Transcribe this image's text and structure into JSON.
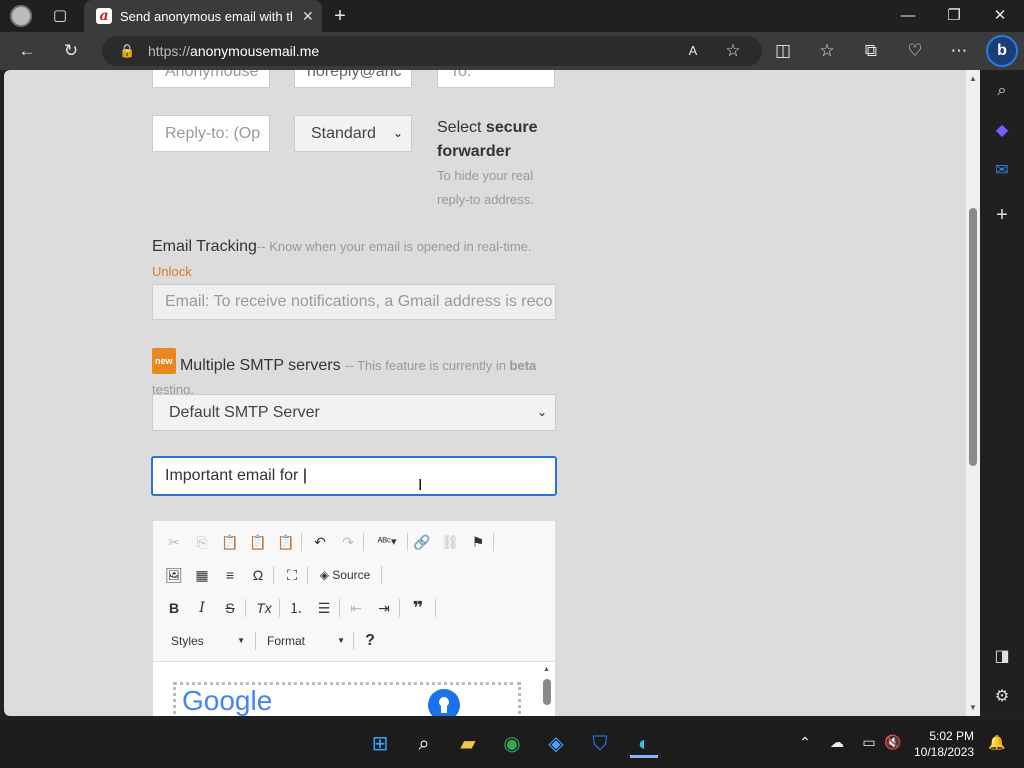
{
  "browser": {
    "tab_title": "Send anonymous email with the",
    "url_scheme": "https://",
    "url_host": "anonymousemail.me"
  },
  "form": {
    "from_name_value": "Anonymouse",
    "from_email_value": "noreply@anc",
    "to_placeholder": "To:",
    "reply_to_placeholder": "Reply-to: (Op",
    "priority_value": "Standard",
    "secure_text_prefix": "Select ",
    "secure_text_bold": "secure forwarder",
    "secure_hint": "To hide your real reply-to address.",
    "tracking_label": "Email Tracking",
    "tracking_desc": "-- Know when your email is opened in real-time.",
    "unlock_link": "Unlock",
    "tracking_placeholder": "Email: To receive notifications, a Gmail address is reco",
    "new_badge": "new",
    "smtp_label": "Multiple SMTP servers",
    "smtp_desc": "-- This feature is currently in ",
    "smtp_desc_bold": "beta",
    "smtp_desc_tail": "testing.",
    "smtp_value": "Default SMTP Server",
    "subject_value": "Important email for "
  },
  "editor": {
    "source_label": "Source",
    "styles_label": "Styles",
    "format_label": "Format",
    "help_label": "?",
    "google_text": "Google"
  },
  "taskbar": {
    "time": "5:02 PM",
    "date": "10/18/2023"
  },
  "colors": {
    "unlock": "#e07b22",
    "page_bg": "#dcdcdc",
    "focus_border": "#2a73d8"
  }
}
